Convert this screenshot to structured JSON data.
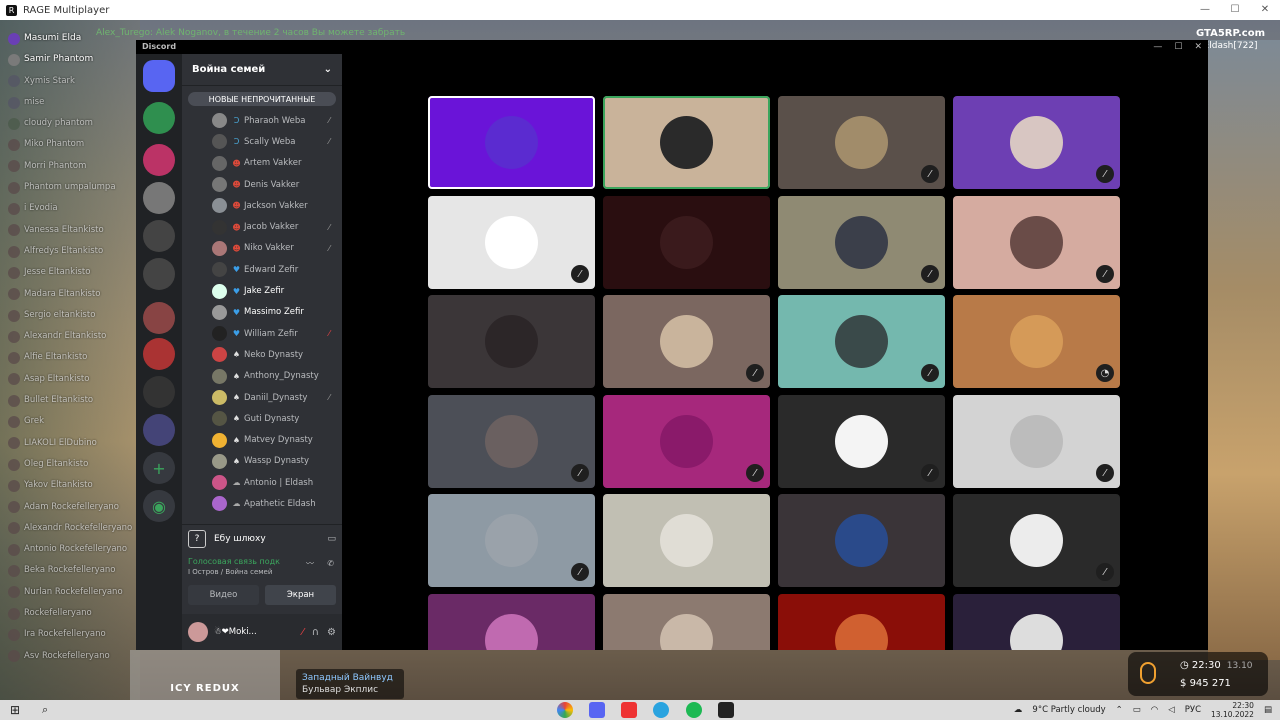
{
  "window": {
    "title": "RAGE Multiplayer",
    "controls": [
      "—",
      "☐",
      "✕"
    ]
  },
  "game": {
    "top_notice": "Alex_Turego: Alek Noganov, в течение 2 часов Вы можете забрать",
    "server": "GTA5RP.com",
    "server_user": "s Eldash[722]",
    "chat": [
      {
        "text": "Masumi Elda",
        "hi": true,
        "color": "#6a3fb5"
      },
      {
        "text": "Samir Phantom",
        "hi": true,
        "color": "#7a7a7a"
      },
      {
        "text": "Xymis Stark",
        "hi": false,
        "color": "#556"
      },
      {
        "text": "mise",
        "hi": false,
        "color": "#556"
      },
      {
        "text": "cloudy phantom",
        "hi": false,
        "color": "#4a5a4a"
      },
      {
        "text": "Miko Phantom",
        "hi": false,
        "color": "#5a4a4a"
      },
      {
        "text": "Morri Phantom",
        "hi": false,
        "color": "#5a4a4a"
      },
      {
        "text": "Phantom umpalumpa",
        "hi": false,
        "color": "#5a4a4a"
      },
      {
        "text": "i Evodia",
        "hi": false,
        "color": "#5a4a4a"
      },
      {
        "text": "Vanessa Eltankisto",
        "hi": false,
        "color": "#5a4a4a"
      },
      {
        "text": "Alfredys Eltankisto",
        "hi": false,
        "color": "#5a4a4a"
      },
      {
        "text": "Jesse Eltankisto",
        "hi": false,
        "color": "#5a4a4a"
      },
      {
        "text": "Madara Eltankisto",
        "hi": false,
        "color": "#5a4a4a"
      },
      {
        "text": "Sergio eltankisto",
        "hi": false,
        "color": "#5a4a4a"
      },
      {
        "text": "Alexandr Eltankisto",
        "hi": false,
        "color": "#5a4a4a"
      },
      {
        "text": "Alfie Eltankisto",
        "hi": false,
        "color": "#5a4a4a"
      },
      {
        "text": "Asap Eltankisto",
        "hi": false,
        "color": "#5a4a4a"
      },
      {
        "text": "Bullet Eltankisto",
        "hi": false,
        "color": "#5a4a4a"
      },
      {
        "text": "Grek",
        "hi": false,
        "color": "#5a4a4a"
      },
      {
        "text": "LIAKOLI ElDubino",
        "hi": false,
        "color": "#5a4a4a"
      },
      {
        "text": "Oleg Eltankisto",
        "hi": false,
        "color": "#5a4a4a"
      },
      {
        "text": "Yakov Eltankisto",
        "hi": false,
        "color": "#5a4a4a"
      },
      {
        "text": "Adam Rockefelleryano",
        "hi": false,
        "color": "#5a4a4a"
      },
      {
        "text": "Alexandr Rockefelleryano",
        "hi": false,
        "color": "#5a4a4a"
      },
      {
        "text": "Antonio Rockefelleryano",
        "hi": false,
        "color": "#5a4a4a"
      },
      {
        "text": "Beka Rockefelleryano",
        "hi": false,
        "color": "#5a4a4a"
      },
      {
        "text": "Nurlan Rockefelleryano",
        "hi": false,
        "color": "#5a4a4a"
      },
      {
        "text": "Rockefelleryano",
        "hi": false,
        "color": "#5a4a4a"
      },
      {
        "text": "Ira Rockefelleryano",
        "hi": false,
        "color": "#5a4a4a"
      },
      {
        "text": "Asv Rockefelleryano",
        "hi": false,
        "color": "#5a4a4a"
      }
    ],
    "minimap_label": "ICY REDUX",
    "location": {
      "district": "Западный Вайнвуд",
      "street": "Бульвар Экплис"
    },
    "hud": {
      "time": "22:30",
      "date": "13.10",
      "money": "945 271"
    }
  },
  "discord": {
    "label": "Discord",
    "server_name": "Война семей",
    "unread_label": "НОВЫЕ НЕПРОЧИТАННЫЕ",
    "guild_colors": [
      "#5865f2",
      "#2f8f4f",
      "#b36",
      "#777",
      "#444",
      "#444",
      "#844",
      "#a33",
      "#333",
      "#447"
    ],
    "members": [
      {
        "name": "Pharaoh Weba",
        "icon": "Ɔ",
        "icon_color": "#4aa8d8",
        "av": "#888",
        "muted": true,
        "red": false
      },
      {
        "name": "Scally Weba",
        "icon": "Ɔ",
        "icon_color": "#4aa8d8",
        "av": "#555",
        "muted": true,
        "red": false
      },
      {
        "name": "Artem Vakker",
        "icon": "☻",
        "icon_color": "#e04a3a",
        "av": "#666",
        "muted": false,
        "red": false
      },
      {
        "name": "Denis Vakker",
        "icon": "☻",
        "icon_color": "#e04a3a",
        "av": "#777",
        "muted": false,
        "red": false
      },
      {
        "name": "Jackson Vakker",
        "icon": "☻",
        "icon_color": "#e04a3a",
        "av": "#8a8f95",
        "muted": false,
        "red": false
      },
      {
        "name": "Jacob Vakker",
        "icon": "☻",
        "icon_color": "#e04a3a",
        "av": "#333",
        "muted": true,
        "red": false
      },
      {
        "name": "Niko Vakker",
        "icon": "☻",
        "icon_color": "#e04a3a",
        "av": "#a77",
        "muted": true,
        "red": false
      },
      {
        "name": "Edward Zefir",
        "icon": "♥",
        "icon_color": "#3b9ee8",
        "av": "#444",
        "muted": false,
        "red": false
      },
      {
        "name": "Jake Zefir",
        "icon": "♥",
        "icon_color": "#3b9ee8",
        "av": "#dfe",
        "muted": false,
        "red": false,
        "me": true
      },
      {
        "name": "Massimo Zefir",
        "icon": "♥",
        "icon_color": "#3b9ee8",
        "av": "#999",
        "muted": false,
        "red": false,
        "me": true
      },
      {
        "name": "William Zefir",
        "icon": "♥",
        "icon_color": "#3b9ee8",
        "av": "#222",
        "muted": true,
        "red": true
      },
      {
        "name": "Neko Dynasty",
        "icon": "♠",
        "icon_color": "#e0e0e0",
        "av": "#c44",
        "muted": false,
        "red": false
      },
      {
        "name": "Anthony_Dynasty",
        "icon": "♠",
        "icon_color": "#e0e0e0",
        "av": "#776",
        "muted": false,
        "red": false
      },
      {
        "name": "Daniil_Dynasty",
        "icon": "♠",
        "icon_color": "#e0e0e0",
        "av": "#cb6",
        "muted": true,
        "red": false
      },
      {
        "name": "Guti Dynasty",
        "icon": "♠",
        "icon_color": "#e0e0e0",
        "av": "#554",
        "muted": false,
        "red": false
      },
      {
        "name": "Matvey Dynasty",
        "icon": "♠",
        "icon_color": "#e0e0e0",
        "av": "#f0b232",
        "muted": false,
        "red": false
      },
      {
        "name": "Wassp Dynasty",
        "icon": "♠",
        "icon_color": "#e0e0e0",
        "av": "#998",
        "muted": false,
        "red": false
      },
      {
        "name": "Antonio | Eldash",
        "icon": "☁",
        "icon_color": "#aaa",
        "av": "#c58",
        "muted": false,
        "red": false
      },
      {
        "name": "Apathetic Eldash",
        "icon": "☁",
        "icon_color": "#aaa",
        "av": "#a6c",
        "muted": false,
        "red": false
      }
    ],
    "text_channel": "Ебу шлюху",
    "voice_status": "Голосовая связь подк",
    "voice_location": "I Остров / Война семей",
    "video_label": "Видео",
    "screen_label": "Экран",
    "self_name": "☃❤Moki...",
    "tiles": [
      {
        "bg": "#6a14d8",
        "face": "#5b2bd0",
        "muted": false,
        "state": "act"
      },
      {
        "bg": "#c9b39a",
        "face": "#2a2a2a",
        "muted": false,
        "state": "sel"
      },
      {
        "bg": "#5a504a",
        "face": "#a18c6a",
        "muted": true,
        "state": ""
      },
      {
        "bg": "#6d3fb3",
        "face": "#d8c6c2",
        "muted": true,
        "state": ""
      },
      {
        "bg": "#e6e6e6",
        "face": "#fff",
        "muted": true,
        "state": ""
      },
      {
        "bg": "#2a0e10",
        "face": "#3a1a1c",
        "muted": false,
        "state": ""
      },
      {
        "bg": "#8f8a73",
        "face": "#3b3f4a",
        "muted": true,
        "state": ""
      },
      {
        "bg": "#d5aba0",
        "face": "#6a4c48",
        "muted": true,
        "state": ""
      },
      {
        "bg": "#3b3638",
        "face": "#2c2628",
        "muted": false,
        "state": ""
      },
      {
        "bg": "#7b6760",
        "face": "#c9b49c",
        "muted": true,
        "state": ""
      },
      {
        "bg": "#74b8ae",
        "face": "#3a4a4a",
        "muted": true,
        "state": ""
      },
      {
        "bg": "#b87a48",
        "face": "#d59a58",
        "muted": false,
        "state": "live"
      },
      {
        "bg": "#4c4f57",
        "face": "#6a6060",
        "muted": true,
        "state": ""
      },
      {
        "bg": "#a6287c",
        "face": "#8a1a6a",
        "muted": true,
        "state": ""
      },
      {
        "bg": "#2a2a2a",
        "face": "#f4f4f4",
        "muted": true,
        "state": ""
      },
      {
        "bg": "#d3d3d3",
        "face": "#bcbcbc",
        "muted": true,
        "state": ""
      },
      {
        "bg": "#8e9aa4",
        "face": "#9aa2aa",
        "muted": true,
        "state": ""
      },
      {
        "bg": "#c1bfb3",
        "face": "#e0ddd5",
        "muted": false,
        "state": ""
      },
      {
        "bg": "#3a3438",
        "face": "#2a4a8a",
        "muted": false,
        "state": ""
      },
      {
        "bg": "#2a2a2a",
        "face": "#ececec",
        "muted": true,
        "state": ""
      },
      {
        "bg": "#6a2a66",
        "face": "#c06ab0",
        "muted": false,
        "state": ""
      },
      {
        "bg": "#8c7a70",
        "face": "#c9b8a8",
        "muted": false,
        "state": ""
      },
      {
        "bg": "#8a0e08",
        "face": "#d06030",
        "muted": false,
        "state": ""
      },
      {
        "bg": "#2a203a",
        "face": "#ddd",
        "muted": false,
        "state": ""
      }
    ]
  },
  "taskbar": {
    "weather": "9°C Partly cloudy",
    "lang": "РУС",
    "time": "22:30",
    "date": "13.10.2022"
  }
}
